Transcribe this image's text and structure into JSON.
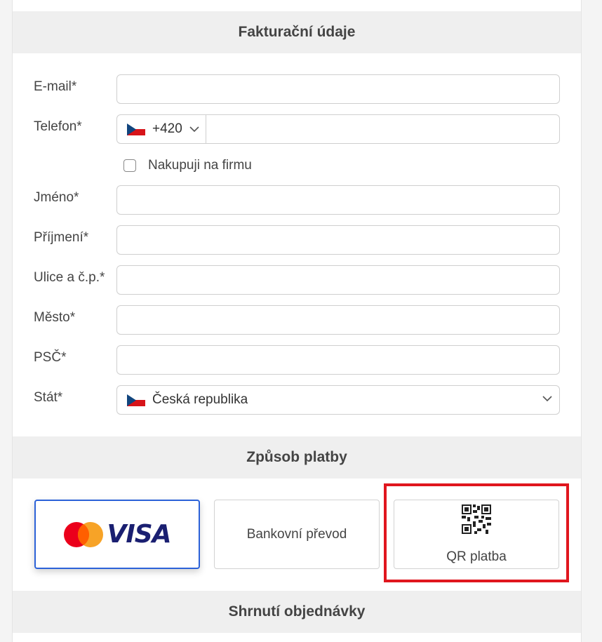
{
  "billing": {
    "title": "Fakturační údaje",
    "email_label": "E-mail*",
    "email_value": "",
    "phone_label": "Telefon*",
    "phone_prefix": "+420",
    "phone_value": "",
    "company_checkbox_label": "Nakupuji na firmu",
    "first_name_label": "Jméno*",
    "last_name_label": "Příjmení*",
    "street_label": "Ulice a č.p.*",
    "city_label": "Město*",
    "zip_label": "PSČ*",
    "country_label": "Stát*",
    "country_value": "Česká republika"
  },
  "payment": {
    "title": "Způsob platby",
    "card_option_logo": "VISA",
    "bank_option_label": "Bankovní převod",
    "qr_option_label": "QR platba",
    "selected": "card",
    "accent_color": "#2c62d8",
    "highlight_color": "#e0161e"
  },
  "summary": {
    "title": "Shrnutí objednávky"
  },
  "icons": {
    "flag": "czech-flag-icon",
    "chevron": "chevron-down-icon",
    "mastercard": "mastercard-logo",
    "qr": "qr-code-icon"
  }
}
